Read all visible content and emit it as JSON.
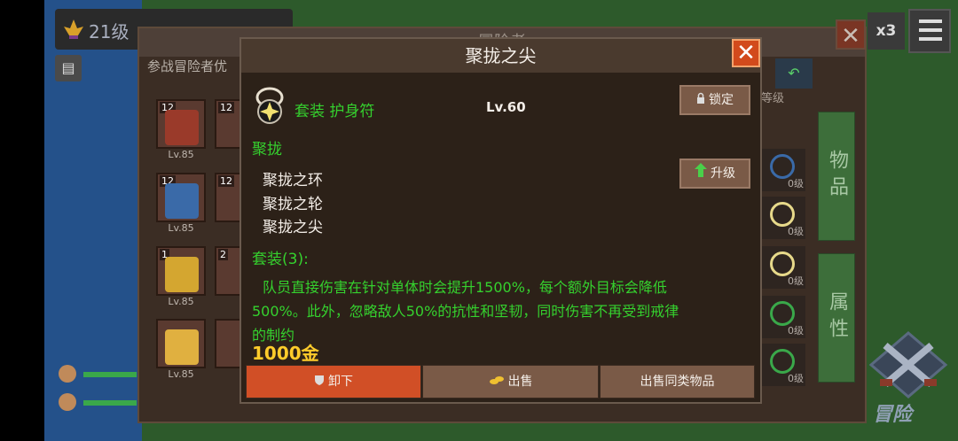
{
  "background": {
    "player_level": "21级",
    "panel_title": "冒险者",
    "panel_subtitle": "参战冒险者优",
    "multiplier": "x3",
    "close_symbol": "✕",
    "tabs": [
      "物品",
      "属性"
    ],
    "adventure_label": "冒险",
    "sort_label": "等级",
    "heroes": [
      {
        "num": "12",
        "level": "Lv.85"
      },
      {
        "num": "12",
        "level": "Lv.85"
      },
      {
        "num": "1",
        "level": "Lv.85"
      },
      {
        "num": "",
        "level": "Lv.85"
      }
    ],
    "heroes_col2": [
      {
        "num": "12"
      },
      {
        "num": "12"
      },
      {
        "num": "2"
      },
      {
        "num": ""
      }
    ],
    "item_levels": [
      "0级",
      "0级",
      "0级",
      "0级",
      "0级"
    ]
  },
  "dialog": {
    "title": "聚拢之尖",
    "close_symbol": "✕",
    "item_type": "套装 护身符",
    "item_level": "Lv.60",
    "lock_label": "锁定",
    "upgrade_label": "升级",
    "set_name": "聚拢",
    "set_pieces": [
      "聚拢之环",
      "聚拢之轮",
      "聚拢之尖"
    ],
    "set_bonus_header": "套装(3):",
    "set_bonus_desc": "队员直接伤害在针对单体时会提升1500%，每个额外目标会降低500%。此外，忽略敌人50%的抗性和坚韧，同时伤害不再受到戒律的制约",
    "price": "1000金",
    "buttons": {
      "unequip": "卸下",
      "sell": "出售",
      "sell_same": "出售同类物品"
    }
  },
  "colors": {
    "accent_green": "#35d12e",
    "gold": "#ffcc2b",
    "close_orange": "#d24a1c",
    "unequip_red": "#d14f26"
  }
}
